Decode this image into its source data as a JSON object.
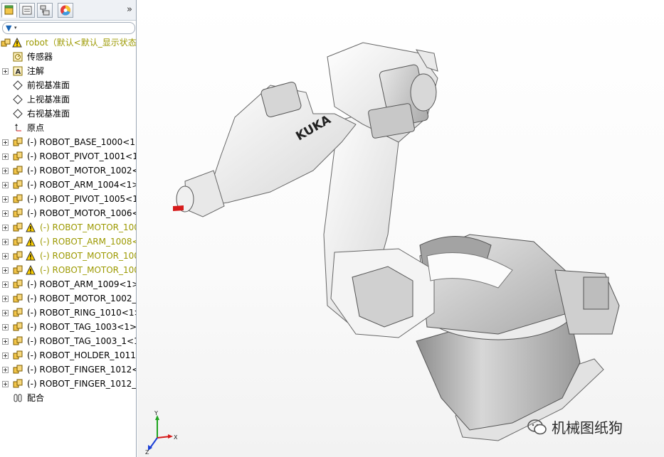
{
  "panel": {
    "tabs": [
      "feature-manager-tab",
      "property-manager-tab",
      "configuration-manager-tab",
      "display-manager-tab"
    ],
    "expand_glyph": "»",
    "filter_icon": "funnel-icon"
  },
  "tree": {
    "root": "robot（默认<默认_显示状态",
    "items": [
      {
        "label": "传感器",
        "icon": "sensor-icon",
        "expand": false,
        "warn": false
      },
      {
        "label": "注解",
        "icon": "annotation-icon",
        "expand": true,
        "warn": false
      },
      {
        "label": "前视基准面",
        "icon": "plane-icon",
        "expand": false,
        "warn": false
      },
      {
        "label": "上视基准面",
        "icon": "plane-icon",
        "expand": false,
        "warn": false
      },
      {
        "label": "右视基准面",
        "icon": "plane-icon",
        "expand": false,
        "warn": false
      },
      {
        "label": "原点",
        "icon": "origin-icon",
        "expand": false,
        "warn": false
      },
      {
        "label": "(-) ROBOT_BASE_1000<1>",
        "icon": "part-icon",
        "expand": true,
        "warn": false
      },
      {
        "label": "(-) ROBOT_PIVOT_1001<1",
        "icon": "part-icon",
        "expand": true,
        "warn": false
      },
      {
        "label": "(-) ROBOT_MOTOR_1002<",
        "icon": "part-icon",
        "expand": true,
        "warn": false
      },
      {
        "label": "(-) ROBOT_ARM_1004<1>",
        "icon": "part-icon",
        "expand": true,
        "warn": false
      },
      {
        "label": "(-) ROBOT_PIVOT_1005<1",
        "icon": "part-icon",
        "expand": true,
        "warn": false
      },
      {
        "label": "(-) ROBOT_MOTOR_1006<",
        "icon": "part-icon",
        "expand": true,
        "warn": false
      },
      {
        "label": "(-) ROBOT_MOTOR_100",
        "icon": "part-icon",
        "expand": true,
        "warn": true
      },
      {
        "label": "(-) ROBOT_ARM_1008<",
        "icon": "part-icon",
        "expand": true,
        "warn": true
      },
      {
        "label": "(-) ROBOT_MOTOR_100",
        "icon": "part-icon",
        "expand": true,
        "warn": true
      },
      {
        "label": "(-) ROBOT_MOTOR_100",
        "icon": "part-icon",
        "expand": true,
        "warn": true
      },
      {
        "label": "(-) ROBOT_ARM_1009<1>",
        "icon": "part-icon",
        "expand": true,
        "warn": false
      },
      {
        "label": "(-) ROBOT_MOTOR_1002_",
        "icon": "part-icon",
        "expand": true,
        "warn": false
      },
      {
        "label": "(-) ROBOT_RING_1010<1>",
        "icon": "part-icon",
        "expand": true,
        "warn": false
      },
      {
        "label": "(-) ROBOT_TAG_1003<1>",
        "icon": "part-icon",
        "expand": true,
        "warn": false
      },
      {
        "label": "(-) ROBOT_TAG_1003_1<1",
        "icon": "part-icon",
        "expand": true,
        "warn": false
      },
      {
        "label": "(-) ROBOT_HOLDER_1011<",
        "icon": "part-icon",
        "expand": true,
        "warn": false
      },
      {
        "label": "(-) ROBOT_FINGER_1012<",
        "icon": "part-icon",
        "expand": true,
        "warn": false
      },
      {
        "label": "(-) ROBOT_FINGER_1012_1",
        "icon": "part-icon",
        "expand": true,
        "warn": false
      },
      {
        "label": "配合",
        "icon": "mates-icon",
        "expand": false,
        "warn": false
      }
    ]
  },
  "viewport": {
    "brand_text": "KUKA",
    "triad_labels": {
      "x": "X",
      "y": "Y",
      "z": "Z"
    },
    "watermark": "机械图纸狗"
  },
  "colors": {
    "warn_text": "#9c9900",
    "selection": "#1b65b5",
    "robot_body": "#f2f2f2",
    "robot_base": "#b9b9b9"
  }
}
